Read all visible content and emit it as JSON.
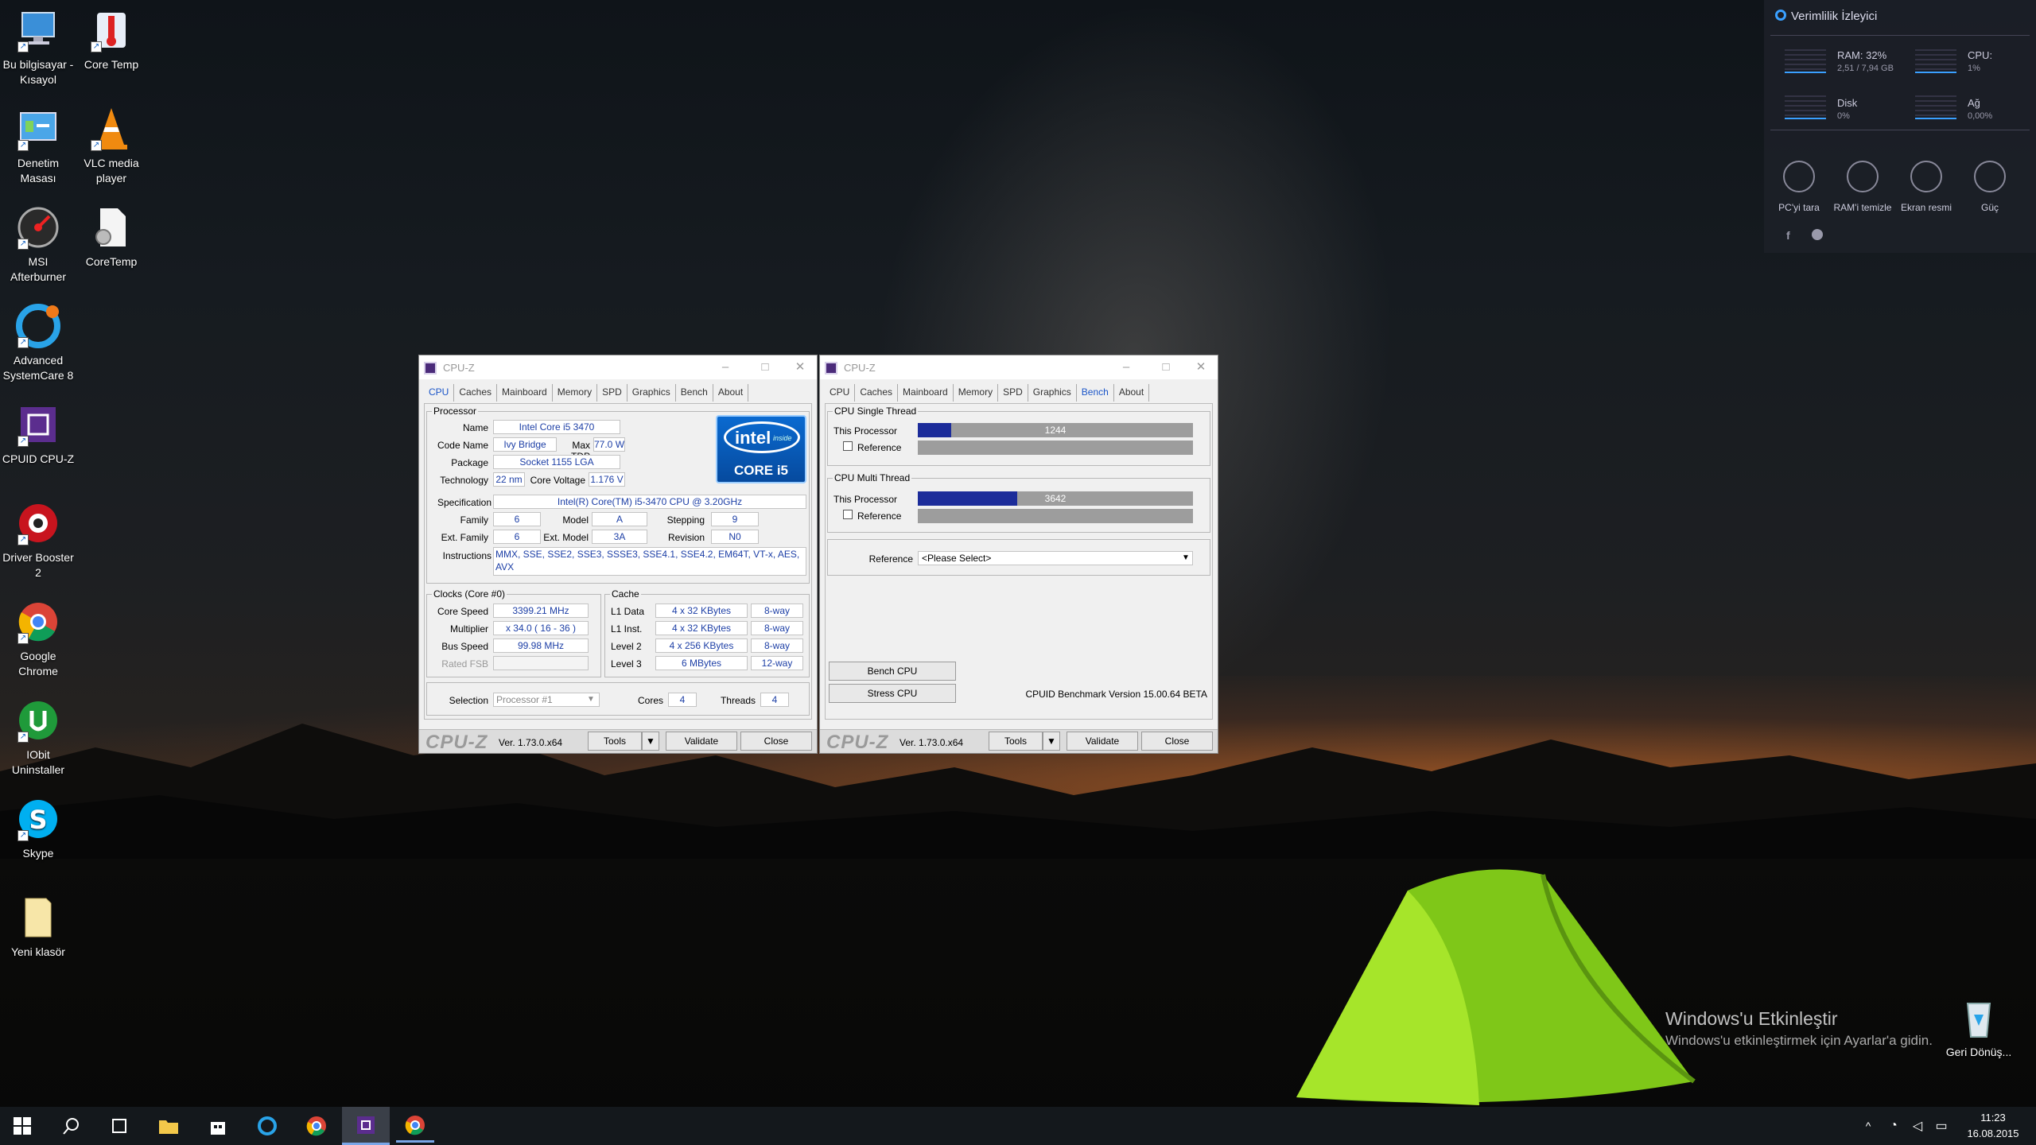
{
  "desktop": {
    "icons": [
      {
        "label": "Bu bilgisayar - Kısayol"
      },
      {
        "label": "Core Temp"
      },
      {
        "label": "Denetim Masası"
      },
      {
        "label": "VLC media player"
      },
      {
        "label": "MSI Afterburner"
      },
      {
        "label": "CoreTemp"
      },
      {
        "label": "Advanced SystemCare 8"
      },
      {
        "label": "CPUID CPU-Z"
      },
      {
        "label": "Driver Booster 2"
      },
      {
        "label": "Google Chrome"
      },
      {
        "label": "IObit Uninstaller"
      },
      {
        "label": "Skype"
      },
      {
        "label": "Yeni klasör"
      },
      {
        "label": "Geri Dönüş..."
      }
    ]
  },
  "cpuz1": {
    "title": "CPU-Z",
    "tabs": [
      "CPU",
      "Caches",
      "Mainboard",
      "Memory",
      "SPD",
      "Graphics",
      "Bench",
      "About"
    ],
    "processor": {
      "legend": "Processor",
      "name_label": "Name",
      "name": "Intel Core i5 3470",
      "codename_label": "Code Name",
      "codename": "Ivy Bridge",
      "maxtdp_label": "Max TDP",
      "maxtdp": "77.0 W",
      "package_label": "Package",
      "package": "Socket 1155 LGA",
      "technology_label": "Technology",
      "technology": "22 nm",
      "voltage_label": "Core Voltage",
      "voltage": "1.176 V",
      "spec_label": "Specification",
      "spec": "Intel(R) Core(TM) i5-3470 CPU @ 3.20GHz",
      "family_label": "Family",
      "family": "6",
      "model_label": "Model",
      "model": "A",
      "stepping_label": "Stepping",
      "stepping": "9",
      "extfamily_label": "Ext. Family",
      "extfamily": "6",
      "extmodel_label": "Ext. Model",
      "extmodel": "3A",
      "revision_label": "Revision",
      "revision": "N0",
      "instructions_label": "Instructions",
      "instructions": "MMX, SSE, SSE2, SSE3, SSSE3, SSE4.1, SSE4.2, EM64T, VT-x, AES, AVX",
      "logo_top": "intel",
      "logo_inside": "inside",
      "logo_bottom": "CORE i5"
    },
    "clocks": {
      "legend": "Clocks (Core #0)",
      "corespeed_label": "Core Speed",
      "corespeed": "3399.21 MHz",
      "multiplier_label": "Multiplier",
      "multiplier": "x 34.0 ( 16 - 36 )",
      "busspeed_label": "Bus Speed",
      "busspeed": "99.98 MHz",
      "ratedfsb_label": "Rated FSB",
      "ratedfsb": ""
    },
    "cache": {
      "legend": "Cache",
      "rows": [
        {
          "label": "L1 Data",
          "size": "4 x 32 KBytes",
          "way": "8-way"
        },
        {
          "label": "L1 Inst.",
          "size": "4 x 32 KBytes",
          "way": "8-way"
        },
        {
          "label": "Level 2",
          "size": "4 x 256 KBytes",
          "way": "8-way"
        },
        {
          "label": "Level 3",
          "size": "6 MBytes",
          "way": "12-way"
        }
      ]
    },
    "selection_label": "Selection",
    "selection": "Processor #1",
    "cores_label": "Cores",
    "cores": "4",
    "threads_label": "Threads",
    "threads": "4",
    "logo": "CPU-Z",
    "version": "Ver. 1.73.0.x64",
    "tools": "Tools",
    "validate": "Validate",
    "close": "Close"
  },
  "cpuz2": {
    "title": "CPU-Z",
    "tabs": [
      "CPU",
      "Caches",
      "Mainboard",
      "Memory",
      "SPD",
      "Graphics",
      "Bench",
      "About"
    ],
    "single": {
      "legend": "CPU Single Thread",
      "this_label": "This Processor",
      "this_value": "1244",
      "this_fraction": 0.12,
      "ref_label": "Reference"
    },
    "multi": {
      "legend": "CPU Multi Thread",
      "this_label": "This Processor",
      "this_value": "3642",
      "this_fraction": 0.36,
      "ref_label": "Reference"
    },
    "reference_label": "Reference",
    "reference_select": "<Please Select>",
    "bench_btn": "Bench CPU",
    "stress_btn": "Stress CPU",
    "bench_version": "CPUID Benchmark Version 15.00.64 BETA",
    "logo": "CPU-Z",
    "version": "Ver. 1.73.0.x64",
    "tools": "Tools",
    "validate": "Validate",
    "close": "Close"
  },
  "widget": {
    "title": "Verimlilik İzleyici",
    "ram_label": "RAM: 32%",
    "ram_sub": "2,51 / 7,94 GB",
    "cpu_label": "CPU:",
    "cpu_sub": "1%",
    "disk_label": "Disk",
    "disk_sub": "0%",
    "net_label": "Ağ",
    "net_sub": "0,00%",
    "actions": [
      "PC'yi tara",
      "RAM'i temizle",
      "Ekran resmi",
      "Güç"
    ]
  },
  "watermark": {
    "title": "Windows'u Etkinleştir",
    "subtitle": "Windows'u etkinleştirmek için Ayarlar'a gidin."
  },
  "taskbar": {
    "time": "11:23",
    "date": "16.08.2015"
  }
}
